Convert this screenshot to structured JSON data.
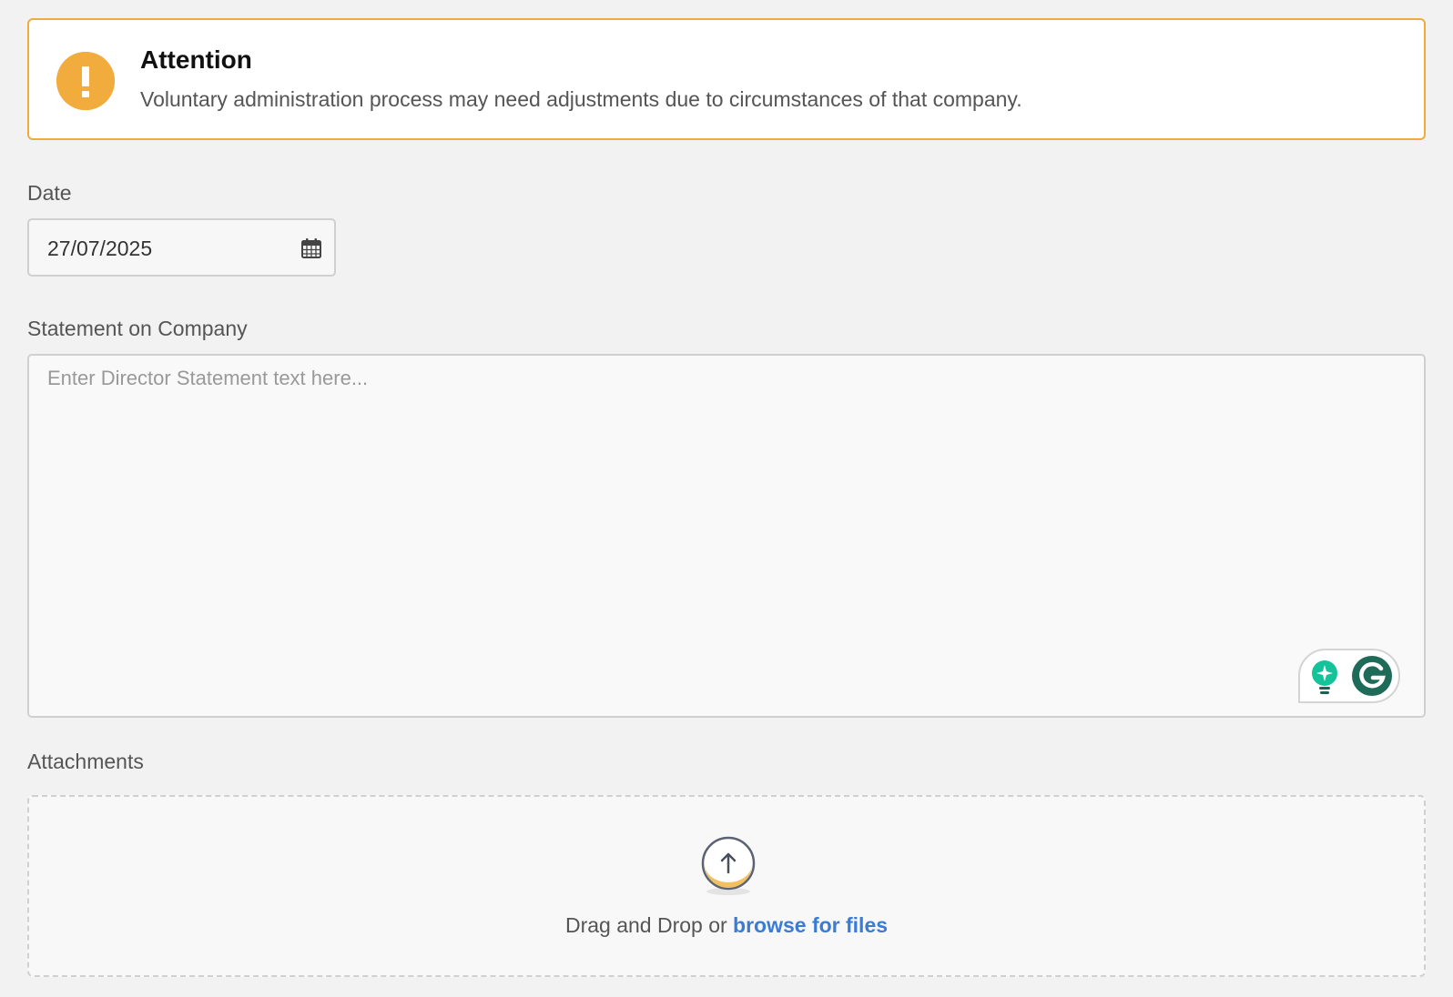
{
  "alert": {
    "title": "Attention",
    "message": "Voluntary administration process may need adjustments due to circumstances of that company.",
    "icon": "exclamation-icon",
    "color": "#f2ab3d"
  },
  "date": {
    "label": "Date",
    "value": "27/07/2025",
    "icon": "calendar-icon"
  },
  "statement": {
    "label": "Statement on Company",
    "placeholder": "Enter Director Statement text here..."
  },
  "grammarly": {
    "icons": [
      "bulb-icon",
      "grammarly-icon"
    ],
    "color": "#15c39a"
  },
  "attachments": {
    "label": "Attachments",
    "prompt": "Drag and Drop or",
    "link": "browse for files",
    "icon": "upload-icon",
    "link_color": "#3a7bd5"
  }
}
